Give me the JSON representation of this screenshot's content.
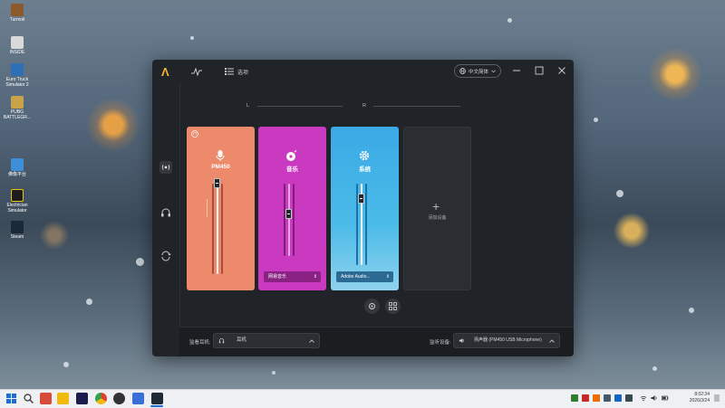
{
  "desktop": {
    "icons": [
      {
        "label": "Turmoil"
      },
      {
        "label": "INSIDE"
      },
      {
        "label": "Euro Truck Simulator 2"
      },
      {
        "label": "PUBG BATTLEGR..."
      },
      {
        "label": "佛像平台"
      },
      {
        "label": "Electrician Simulator"
      },
      {
        "label": "Steam"
      }
    ]
  },
  "app": {
    "titlebar": {
      "list_label": "选项",
      "language": "中文简体"
    },
    "channels": {
      "left_label": "L",
      "right_label": "R"
    },
    "cards": [
      {
        "name": "PM450",
        "color": "#ec8a6b",
        "icon": "microphone-icon",
        "level": 0.72
      },
      {
        "name": "音乐",
        "color": "#c93ac1",
        "icon": "music-icon",
        "level": 0.45,
        "dropdown": "网易音乐"
      },
      {
        "name": "系统",
        "color": "#3aa9e6",
        "icon": "gear-icon",
        "level": 0.62,
        "dropdown": "Adobe Audio..."
      }
    ],
    "add_device_label": "添加设备",
    "footer": {
      "monitor_label": "监看耳机:",
      "monitor_value": "耳机",
      "output_label": "监听设备:",
      "output_value": "扬声器 (PM450 USB Microphone)"
    }
  },
  "taskbar": {
    "time": "8:02:34",
    "date": "2026/3/24"
  },
  "colors": {
    "accent": "#f5b52e",
    "window_bg": "#202327"
  }
}
